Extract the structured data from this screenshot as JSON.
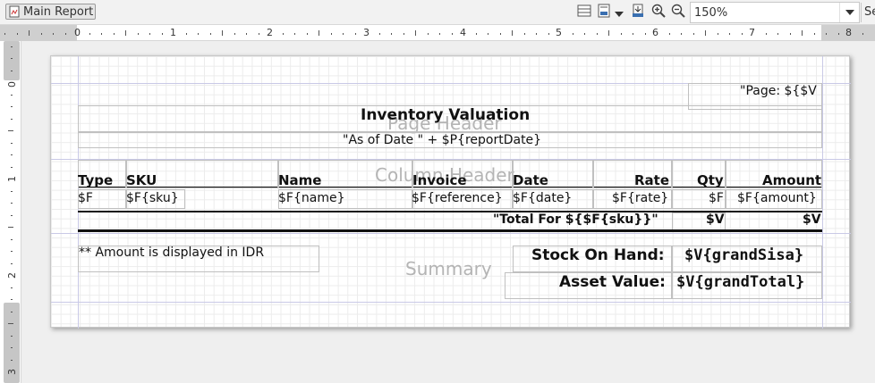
{
  "toolbar": {
    "report_tab_label": "Main Report",
    "zoom_value": "150%",
    "next_tab_label": "Se",
    "colors": {
      "toolbar_bg": "#f2f2f2",
      "page_bg": "#ffffff"
    },
    "icons": [
      "page-layout-icon",
      "grid-snap-icon",
      "dropdown-arrow-icon",
      "export-icon",
      "zoom-in-icon",
      "zoom-out-icon"
    ]
  },
  "ruler": {
    "h_numbers": [
      "0",
      "1",
      "2",
      "3",
      "4",
      "5",
      "6",
      "7",
      "8"
    ],
    "v_numbers": [
      "0",
      "1",
      "2",
      "3"
    ]
  },
  "bands": {
    "page_header": "Page Header",
    "column_header": "Column Header",
    "summary": "Summary"
  },
  "page_header": {
    "page_no": "\"Page: ${$V",
    "title": "Inventory Valuation",
    "as_of": "\"As of Date \" + $P{reportDate}"
  },
  "columns": {
    "headers": [
      "Type",
      "SKU",
      "Name",
      "Invoice",
      "Date",
      "Rate",
      "Qty",
      "Amount"
    ],
    "detail": [
      "$F",
      "$F{sku}",
      "$F{name}",
      "$F{reference}",
      "$F{date}",
      "$F{rate}",
      "$F",
      "$F{amount}"
    ],
    "group_footer_label": "\"Total For ${$F{sku}}\"",
    "group_footer_qty": "$V",
    "group_footer_amount": "$V"
  },
  "summary": {
    "note": "** Amount is displayed in IDR",
    "stock_label": "Stock On Hand:",
    "stock_value": "$V{grandSisa}",
    "asset_label": "Asset Value:",
    "asset_value": "$V{grandTotal}"
  }
}
